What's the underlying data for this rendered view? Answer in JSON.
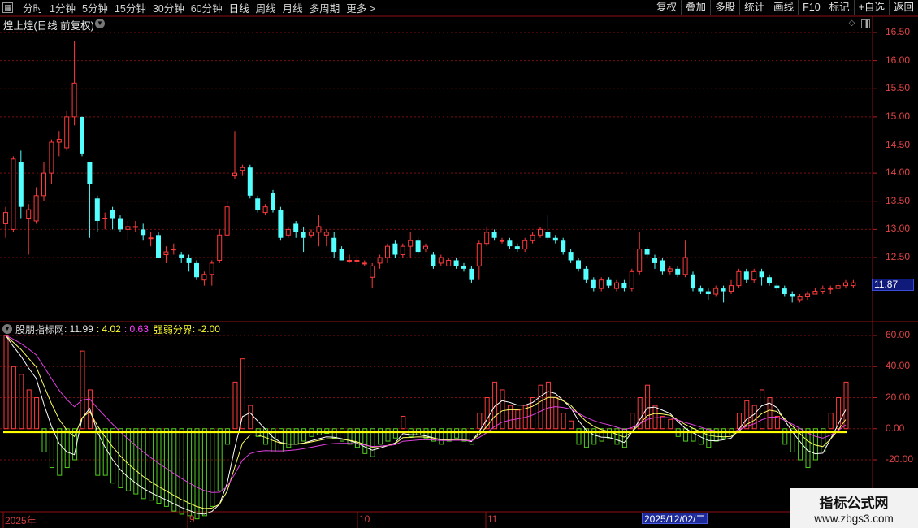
{
  "toolbar": {
    "menu_icon": "grid-menu-icon",
    "periods": [
      "分时",
      "1分钟",
      "5分钟",
      "15分钟",
      "30分钟",
      "60分钟",
      "日线",
      "周线",
      "月线",
      "多周期",
      "更多 >"
    ],
    "active_period": "日线",
    "right_buttons": [
      "复权",
      "叠加",
      "多股",
      "统计",
      "画线",
      "F10",
      "标记",
      "+自选",
      "返回"
    ]
  },
  "stock": {
    "title": "煌上煌(日线 前复权)",
    "last_price": "11.87"
  },
  "price_axis": [
    "16.50",
    "16.00",
    "15.50",
    "15.00",
    "14.50",
    "14.00",
    "13.50",
    "13.00",
    "12.50"
  ],
  "indicator": {
    "name": "股朋指标网",
    "val1": ": 11.99",
    "val2": ": 4.02",
    "val3": ": 0.63",
    "strong_label": "强弱分界",
    "strong_val": ": -2.00",
    "axis": [
      "60.00",
      "40.00",
      "20.00",
      "0.00",
      "-20.00"
    ]
  },
  "x_axis": {
    "labels": [
      "2025年",
      "9",
      "10",
      "11"
    ],
    "cursor_date": "2025/12/02/二"
  },
  "colors": {
    "up": "#ff3b3b",
    "down": "#54ffff",
    "grid": "#8b1010",
    "yellow_line": "#ffff00",
    "green_bar": "#4fd11f",
    "magenta": "#e040e0"
  },
  "watermark": {
    "line1": "指标公式网",
    "line2": "www.zbgs3.com"
  },
  "chart_data": {
    "type": "candlestick",
    "y_range": [
      11.4,
      16.6
    ],
    "candles": [
      [
        13.1,
        13.3,
        12.85,
        13.4
      ],
      [
        13.0,
        14.25,
        12.95,
        14.3
      ],
      [
        14.2,
        13.4,
        13.2,
        14.4
      ],
      [
        13.2,
        13.35,
        12.55,
        13.45
      ],
      [
        13.15,
        13.6,
        13.1,
        13.75
      ],
      [
        13.6,
        14.0,
        13.5,
        14.2
      ],
      [
        14.0,
        14.55,
        13.8,
        14.6
      ],
      [
        14.55,
        14.6,
        14.3,
        14.75
      ],
      [
        14.45,
        15.0,
        14.4,
        15.1
      ],
      [
        15.0,
        15.6,
        14.85,
        16.35
      ],
      [
        15.0,
        14.35,
        14.3,
        15.0
      ],
      [
        14.2,
        13.8,
        12.85,
        14.2
      ],
      [
        13.55,
        13.15,
        12.95,
        13.6
      ],
      [
        13.2,
        13.2,
        13.0,
        13.3
      ],
      [
        13.35,
        13.2,
        13.0,
        13.4
      ],
      [
        13.2,
        13.0,
        12.95,
        13.25
      ],
      [
        13.0,
        13.05,
        12.8,
        13.15
      ],
      [
        13.05,
        13.05,
        12.95,
        13.15
      ],
      [
        13.0,
        12.9,
        12.8,
        13.1
      ],
      [
        12.85,
        12.85,
        12.7,
        12.95
      ],
      [
        12.9,
        12.5,
        12.5,
        12.95
      ],
      [
        12.55,
        12.6,
        12.4,
        12.7
      ],
      [
        12.65,
        12.65,
        12.55,
        12.75
      ],
      [
        12.55,
        12.5,
        12.4,
        12.6
      ],
      [
        12.5,
        12.4,
        12.25,
        12.55
      ],
      [
        12.4,
        12.15,
        12.1,
        12.45
      ],
      [
        12.1,
        12.2,
        12.0,
        12.25
      ],
      [
        12.2,
        12.4,
        12.0,
        12.45
      ],
      [
        12.45,
        12.9,
        12.4,
        13.0
      ],
      [
        12.9,
        13.4,
        12.9,
        13.5
      ],
      [
        13.95,
        14.0,
        13.9,
        14.75
      ],
      [
        14.05,
        14.1,
        13.95,
        14.15
      ],
      [
        14.1,
        13.6,
        13.55,
        14.15
      ],
      [
        13.55,
        13.35,
        13.3,
        13.6
      ],
      [
        13.3,
        13.4,
        13.25,
        13.45
      ],
      [
        13.65,
        13.35,
        13.3,
        13.7
      ],
      [
        13.35,
        12.85,
        12.8,
        13.4
      ],
      [
        12.9,
        13.0,
        12.85,
        13.05
      ],
      [
        13.1,
        12.95,
        12.85,
        13.15
      ],
      [
        12.95,
        12.85,
        12.6,
        13.05
      ],
      [
        12.9,
        12.95,
        12.85,
        13.0
      ],
      [
        12.95,
        13.05,
        12.7,
        13.25
      ],
      [
        12.9,
        12.95,
        12.7,
        13.0
      ],
      [
        12.85,
        12.6,
        12.5,
        12.95
      ],
      [
        12.65,
        12.45,
        12.45,
        12.7
      ],
      [
        12.45,
        12.45,
        12.4,
        12.55
      ],
      [
        12.45,
        12.45,
        12.35,
        12.55
      ],
      [
        12.4,
        12.4,
        12.35,
        12.45
      ],
      [
        12.15,
        12.35,
        11.95,
        12.4
      ],
      [
        12.4,
        12.5,
        12.3,
        12.55
      ],
      [
        12.5,
        12.7,
        12.4,
        12.75
      ],
      [
        12.75,
        12.55,
        12.5,
        12.8
      ],
      [
        12.55,
        12.7,
        12.5,
        12.75
      ],
      [
        12.7,
        12.8,
        12.5,
        12.95
      ],
      [
        12.8,
        12.6,
        12.55,
        12.85
      ],
      [
        12.65,
        12.7,
        12.6,
        12.75
      ],
      [
        12.55,
        12.35,
        12.3,
        12.6
      ],
      [
        12.4,
        12.5,
        12.35,
        12.55
      ],
      [
        12.35,
        12.45,
        12.35,
        12.5
      ],
      [
        12.45,
        12.35,
        12.3,
        12.5
      ],
      [
        12.35,
        12.3,
        12.25,
        12.4
      ],
      [
        12.3,
        12.1,
        12.05,
        12.35
      ],
      [
        12.35,
        12.75,
        12.1,
        12.8
      ],
      [
        12.75,
        12.95,
        12.7,
        13.05
      ],
      [
        12.95,
        12.85,
        12.8,
        13.0
      ],
      [
        12.8,
        12.8,
        12.75,
        12.85
      ],
      [
        12.8,
        12.7,
        12.65,
        12.85
      ],
      [
        12.7,
        12.65,
        12.6,
        12.75
      ],
      [
        12.65,
        12.8,
        12.6,
        12.85
      ],
      [
        12.8,
        12.9,
        12.75,
        12.95
      ],
      [
        12.9,
        13.0,
        12.85,
        13.05
      ],
      [
        12.95,
        12.85,
        12.8,
        13.25
      ],
      [
        12.85,
        12.8,
        12.75,
        12.9
      ],
      [
        12.8,
        12.6,
        12.55,
        12.85
      ],
      [
        12.6,
        12.45,
        12.4,
        12.65
      ],
      [
        12.45,
        12.3,
        12.25,
        12.5
      ],
      [
        12.3,
        12.1,
        12.05,
        12.35
      ],
      [
        12.1,
        11.95,
        11.9,
        12.15
      ],
      [
        11.95,
        12.1,
        11.9,
        12.15
      ],
      [
        12.1,
        12.0,
        11.95,
        12.15
      ],
      [
        11.95,
        12.05,
        11.9,
        12.1
      ],
      [
        12.05,
        11.95,
        11.9,
        12.1
      ],
      [
        11.95,
        12.25,
        11.9,
        12.3
      ],
      [
        12.25,
        12.65,
        12.2,
        12.95
      ],
      [
        12.65,
        12.55,
        12.5,
        12.7
      ],
      [
        12.5,
        12.4,
        12.3,
        12.55
      ],
      [
        12.45,
        12.25,
        12.2,
        12.5
      ],
      [
        12.25,
        12.3,
        12.2,
        12.35
      ],
      [
        12.3,
        12.2,
        12.15,
        12.35
      ],
      [
        12.2,
        12.5,
        12.15,
        12.8
      ],
      [
        12.2,
        11.95,
        11.9,
        12.25
      ],
      [
        11.95,
        11.9,
        11.85,
        12.0
      ],
      [
        11.9,
        11.85,
        11.75,
        11.95
      ],
      [
        11.85,
        11.95,
        11.8,
        12.0
      ],
      [
        11.95,
        11.9,
        11.7,
        12.0
      ],
      [
        11.9,
        12.0,
        11.85,
        12.1
      ],
      [
        12.0,
        12.25,
        11.95,
        12.3
      ],
      [
        12.25,
        12.1,
        12.05,
        12.3
      ],
      [
        12.1,
        12.25,
        12.05,
        12.3
      ],
      [
        12.25,
        12.15,
        12.0,
        12.3
      ],
      [
        12.15,
        12.05,
        12.0,
        12.2
      ],
      [
        12.0,
        11.95,
        11.9,
        12.05
      ],
      [
        11.95,
        11.85,
        11.8,
        12.0
      ],
      [
        11.85,
        11.8,
        11.7,
        11.9
      ],
      [
        11.75,
        11.8,
        11.7,
        11.85
      ],
      [
        11.8,
        11.85,
        11.75,
        11.9
      ],
      [
        11.85,
        11.9,
        11.85,
        11.95
      ],
      [
        11.9,
        11.95,
        11.85,
        12.0
      ],
      [
        11.95,
        11.95,
        11.85,
        12.0
      ],
      [
        11.95,
        12.0,
        11.95,
        12.05
      ],
      [
        12.0,
        12.05,
        11.95,
        12.1
      ],
      [
        12.0,
        12.05,
        11.95,
        12.1
      ]
    ],
    "indicator_range": [
      -30,
      65
    ],
    "hist": [
      60,
      40,
      35,
      25,
      20,
      -15,
      -25,
      -30,
      -25,
      -20,
      50,
      25,
      -30,
      -30,
      -35,
      -38,
      -40,
      -42,
      -45,
      -46,
      -48,
      -50,
      -53,
      -55,
      -56,
      -58,
      -56,
      -50,
      -40,
      -10,
      30,
      45,
      15,
      -5,
      -10,
      -15,
      -15,
      -12,
      -10,
      -8,
      -5,
      -4,
      -3,
      -6,
      -8,
      -10,
      -12,
      -16,
      -18,
      -10,
      -8,
      -6,
      8,
      -5,
      -4,
      -6,
      -8,
      -10,
      -8,
      -6,
      -8,
      -10,
      10,
      20,
      30,
      25,
      15,
      12,
      15,
      20,
      28,
      30,
      20,
      10,
      5,
      -10,
      -12,
      -10,
      -8,
      -6,
      -10,
      -12,
      10,
      20,
      28,
      15,
      8,
      6,
      -5,
      -8,
      -8,
      -10,
      -12,
      -8,
      -6,
      -4,
      10,
      18,
      15,
      25,
      20,
      8,
      -10,
      -15,
      -20,
      -25,
      -20,
      -15,
      10,
      20,
      30
    ],
    "strong_line": -2.0
  }
}
